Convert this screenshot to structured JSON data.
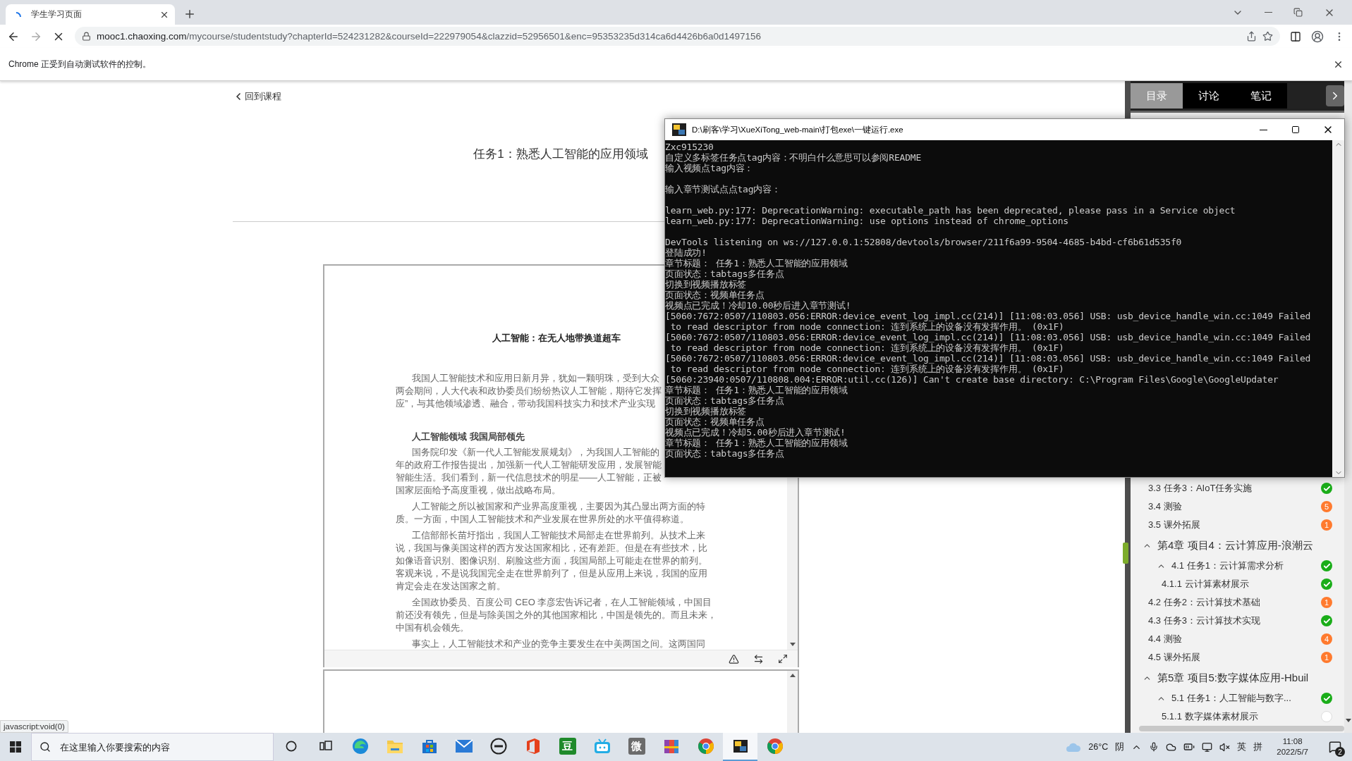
{
  "browser": {
    "tab": {
      "title": "学生学习页面",
      "selected": true
    },
    "url": {
      "host": "mooc1.chaoxing.com",
      "path": "/mycourse/studentstudy?chapterId=524231282&courseId=222979054&clazzid=52956501&enc=95353235d314ca6d4426b6a0d1497156"
    },
    "infobar": "Chrome 正受到自动测试软件的控制。",
    "status_text": "javascript:void(0)"
  },
  "page": {
    "back_link": "回到课程",
    "title": "任务1：熟悉人工智能的应用领域",
    "document": {
      "title": "人工智能：在无人地带换道超车",
      "blocks": [
        {
          "kind": "paragraph",
          "lines": [
            "我国人工智能技术和应用日新月异，犹如一颗明珠，受到大众",
            "两会期间，人大代表和政协委员们纷纷热议人工智能，期待它发挥",
            "应”，与其他领域渗透、融合，带动我国科技实力和技术产业实现"
          ]
        },
        {
          "kind": "heading",
          "lines": [
            "人工智能领域 我国局部领先"
          ]
        },
        {
          "kind": "paragraph",
          "lines": [
            "国务院印发《新一代人工智能发展规划》，为我国人工智能的",
            "年的政府工作报告提出，加强新一代人工智能研发应用，发展智能",
            "智能生活。我们看到，新一代信息技术的明星——人工智能，正被",
            "国家层面给予高度重视，做出战略布局。"
          ]
        },
        {
          "kind": "paragraph",
          "lines": [
            "人工智能之所以被国家和产业界高度重视，主要因为其凸显出两方面的特",
            "质。一方面，中国人工智能技术和产业发展在世界所处的水平值得称道。"
          ]
        },
        {
          "kind": "paragraph",
          "lines": [
            "工信部部长苗圩指出，我国人工智能技术局部走在世界前列。从技术上来",
            "说，我国与像美国这样的西方发达国家相比，还有差距。但是在有些技术，比",
            "如像语音识别、图像识别、刷脸这些方面，我国局部上可能走在世界的前列。",
            "客观来说，不是说我国完全走在世界前列了，但是从应用上来说，我国的应用",
            "肯定会走在发达国家之前。"
          ]
        },
        {
          "kind": "paragraph",
          "lines": [
            "全国政协委员、百度公司 CEO 李彦宏告诉记者，在人工智能领域，中国目",
            "前还没有领先，但是与除美国之外的其他国家相比，中国是领先的。而且未来，",
            "中国有机会领先。"
          ]
        },
        {
          "kind": "paragraph",
          "lines": [
            "事实上，人工智能技术和产业的竞争主要发生在中美两国之间。这两国同"
          ]
        }
      ]
    }
  },
  "sidebar": {
    "tabs": [
      {
        "label": "目录",
        "selected": true
      },
      {
        "label": "讨论",
        "selected": false
      },
      {
        "label": "笔记",
        "selected": false
      }
    ],
    "outline": [
      {
        "kind": "section",
        "label": "3.3 任务3：AIoT任务实施",
        "done": true
      },
      {
        "kind": "section",
        "label": "3.4 测验",
        "done": false,
        "count": "5"
      },
      {
        "kind": "section",
        "label": "3.5 课外拓展",
        "done": false,
        "count": "1"
      },
      {
        "kind": "chapter",
        "label": "第4章 项目4：云计算应用-浪潮云",
        "expanded": true,
        "children": [
          {
            "kind": "section",
            "label": "4.1 任务1：云计算需求分析",
            "done": true,
            "expanded": true,
            "children": [
              {
                "kind": "section",
                "label": "4.1.1 云计算素材展示",
                "done": true
              }
            ]
          },
          {
            "kind": "section",
            "label": "4.2 任务2：云计算技术基础",
            "done": false,
            "count": "1"
          },
          {
            "kind": "section",
            "label": "4.3 任务3：云计算技术实现",
            "done": true
          },
          {
            "kind": "section",
            "label": "4.4 测验",
            "done": false,
            "count": "4"
          },
          {
            "kind": "section",
            "label": "4.5 课外拓展",
            "done": false,
            "count": "1"
          }
        ]
      },
      {
        "kind": "chapter",
        "label": "第5章 项目5:数字媒体应用-Hbuil",
        "expanded": true,
        "children": [
          {
            "kind": "section",
            "label": "5.1 任务1：人工智能与数字...",
            "done": true,
            "expanded": true,
            "children": [
              {
                "kind": "section",
                "label": "5.1.1 数字媒体素材展示",
                "done": false
              }
            ]
          }
        ]
      }
    ]
  },
  "console": {
    "title": "D:\\刷客\\学习\\XueXiTong_web-main\\打包exe\\一键运行.exe",
    "lines": [
      {
        "text": "Zxc915230"
      },
      {
        "text": "自定义多标签任务点tag内容：不明白什么意思可以参阅README"
      },
      {
        "text": "输入视频点tag内容："
      },
      {
        "text": "输入章节测试点点tag内容：",
        "space_before": true
      },
      {
        "text": "learn_web.py:177: DeprecationWarning: executable_path has been deprecated, please pass in a Service object",
        "space_before": true
      },
      {
        "text": "learn_web.py:177: DeprecationWarning: use options instead of chrome_options"
      },
      {
        "text": "DevTools listening on ws://127.0.0.1:52808/devtools/browser/211f6a99-9504-4685-b4bd-cf6b61d535f0",
        "space_before": true
      },
      {
        "text": "登陆成功!"
      },
      {
        "text": "章节标题： 任务1：熟悉人工智能的应用领域"
      },
      {
        "text": "页面状态：tabtags多任务点"
      },
      {
        "text": "切换到视频播放标签"
      },
      {
        "text": "页面状态：视频单任务点"
      },
      {
        "text": "视频点已完成！冷却10.00秒后进入章节测试!"
      },
      {
        "text": "[5060:7672:0507/110803.056:ERROR:device_event_log_impl.cc(214)] [11:08:03.056] USB: usb_device_handle_win.cc:1049 Failed"
      },
      {
        "text": " to read descriptor from node connection: 连到系统上的设备没有发挥作用。 (0x1F)"
      },
      {
        "text": "[5060:7672:0507/110803.056:ERROR:device_event_log_impl.cc(214)] [11:08:03.056] USB: usb_device_handle_win.cc:1049 Failed"
      },
      {
        "text": " to read descriptor from node connection: 连到系统上的设备没有发挥作用。 (0x1F)"
      },
      {
        "text": "[5060:7672:0507/110803.056:ERROR:device_event_log_impl.cc(214)] [11:08:03.056] USB: usb_device_handle_win.cc:1049 Failed"
      },
      {
        "text": " to read descriptor from node connection: 连到系统上的设备没有发挥作用。 (0x1F)"
      },
      {
        "text": "[5060:23940:0507/110808.004:ERROR:util.cc(126)] Can't create base directory: C:\\Program Files\\Google\\GoogleUpdater"
      },
      {
        "text": "章节标题： 任务1：熟悉人工智能的应用领域"
      },
      {
        "text": "页面状态：tabtags多任务点"
      },
      {
        "text": "切换到视频播放标签"
      },
      {
        "text": "页面状态：视频单任务点"
      },
      {
        "text": "视频点已完成！冷却5.00秒后进入章节测试!"
      },
      {
        "text": "章节标题： 任务1：熟悉人工智能的应用领域"
      },
      {
        "text": "页面状态：tabtags多任务点"
      }
    ]
  },
  "taskbar": {
    "search_placeholder": "在这里输入你要搜索的内容",
    "apps": [
      {
        "kind": "edge",
        "selected": false
      },
      {
        "kind": "folder",
        "selected": false
      },
      {
        "kind": "store",
        "selected": false
      },
      {
        "kind": "mail",
        "selected": false
      },
      {
        "kind": "dell",
        "selected": false
      },
      {
        "kind": "office",
        "selected": false
      },
      {
        "kind": "letter",
        "glyph": "豆",
        "color": "#1f8a2b",
        "selected": false
      },
      {
        "kind": "tv",
        "selected": false
      },
      {
        "kind": "letter",
        "glyph": "微",
        "color": "#6b6b6b",
        "selected": false
      },
      {
        "kind": "books",
        "selected": false
      },
      {
        "kind": "chrome",
        "selected": false
      },
      {
        "kind": "console",
        "selected": true
      },
      {
        "kind": "chrome",
        "selected": false
      }
    ],
    "weather": {
      "temp": "26°C",
      "condition": "阴"
    },
    "ime": [
      "英",
      "拼"
    ],
    "time": "11:08",
    "date": "2022/5/7",
    "notifications": "2"
  }
}
